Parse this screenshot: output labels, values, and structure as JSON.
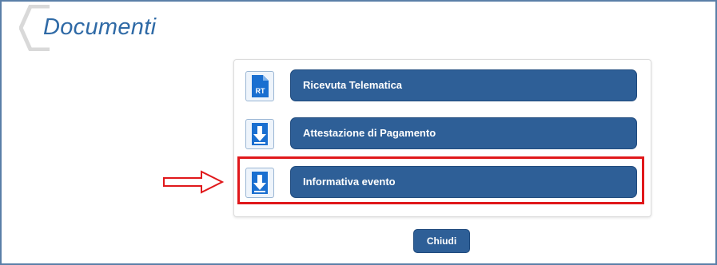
{
  "window": {
    "title": "Documenti"
  },
  "documents": [
    {
      "label": "Ricevuta Telematica",
      "icon": "rt-document-icon",
      "icon_text": "RT"
    },
    {
      "label": "Attestazione di Pagamento",
      "icon": "download-icon"
    },
    {
      "label": "Informativa evento",
      "icon": "download-icon",
      "highlighted": true
    }
  ],
  "footer": {
    "close_label": "Chiudi"
  },
  "colors": {
    "button": "#2e5f97",
    "title": "#2f6aa6",
    "highlight": "#e0181b",
    "icon": "#1a6fd0"
  }
}
